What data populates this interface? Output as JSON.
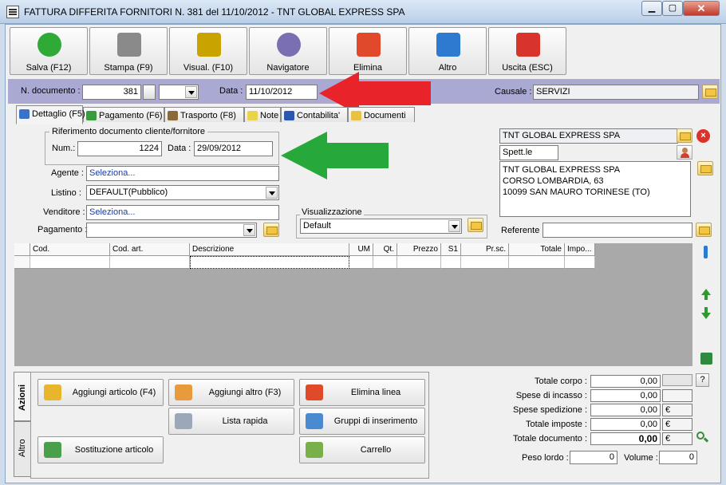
{
  "window": {
    "title": "FATTURA DIFFERITA FORNITORI N. 381  del 11/10/2012 - TNT GLOBAL EXPRESS SPA",
    "minimize": "▁",
    "maximize": "▢",
    "close": "✕"
  },
  "toolbar": [
    {
      "label": "Salva (F12)",
      "icon": "check-icon",
      "color": "#2faa36"
    },
    {
      "label": "Stampa (F9)",
      "icon": "printer-icon",
      "color": "#8a8a8a"
    },
    {
      "label": "Visual. (F10)",
      "icon": "magic-wand-icon",
      "color": "#c9a400"
    },
    {
      "label": "Navigatore",
      "icon": "compass-icon",
      "color": "#7a6fb0"
    },
    {
      "label": "Elimina",
      "icon": "delete-x-icon",
      "color": "#e04a2a"
    },
    {
      "label": "Altro",
      "icon": "search-doc-icon",
      "color": "#2e7ad1"
    },
    {
      "label": "Uscita (ESC)",
      "icon": "exit-icon",
      "color": "#d9342b"
    }
  ],
  "document": {
    "number_label": "N. documento :",
    "number": "381",
    "series": "",
    "date_label": "Data :",
    "date": "11/10/2012",
    "causale_label": "Causale :",
    "causale": "SERVIZI"
  },
  "tabs": [
    {
      "label": "Dettaglio (F5)",
      "icon": "calendar-icon",
      "color": "#3a72c9"
    },
    {
      "label": "Pagamento (F6)",
      "icon": "money-icon",
      "color": "#3b9a3b"
    },
    {
      "label": "Trasporto (F8)",
      "icon": "truck-icon",
      "color": "#8a6a3a"
    },
    {
      "label": "Note",
      "icon": "note-icon",
      "color": "#e8d34a"
    },
    {
      "label": "Contabilita'",
      "icon": "book-icon",
      "color": "#2a58b0"
    },
    {
      "label": "Documenti",
      "icon": "folder-icon",
      "color": "#e9c243"
    }
  ],
  "reference": {
    "group_label": "Riferimento documento cliente/fornitore",
    "num_label": "Num.:",
    "num": "1224",
    "date_label": "Data :",
    "date": "29/09/2012"
  },
  "fields": {
    "agente_label": "Agente :",
    "agente": "Seleziona...",
    "listino_label": "Listino :",
    "listino": "DEFAULT(Pubblico)",
    "venditore_label": "Venditore :",
    "venditore": "Seleziona...",
    "pagamento_label": "Pagamento :",
    "pagamento": "",
    "visual_label": "Visualizzazione",
    "visual": "Default"
  },
  "customer": {
    "name": "TNT GLOBAL EXPRESS SPA",
    "salutation": "Spett.le",
    "address_lines": [
      "TNT GLOBAL EXPRESS SPA",
      "CORSO LOMBARDIA, 63",
      "10099 SAN MAURO TORINESE (TO)"
    ],
    "referente_label": "Referente",
    "referente": ""
  },
  "grid": {
    "columns": [
      "Cod.",
      "Cod. art.",
      "Descrizione",
      "UM",
      "Qt.",
      "Prezzo",
      "S1",
      "Pr.sc.",
      "Totale",
      "Impo..."
    ]
  },
  "side_tabs": {
    "azioni": "Azioni",
    "altro": "Altro"
  },
  "actions": [
    {
      "label": "Aggiungi articolo (F4)",
      "icon": "add-box-icon",
      "color": "#e8b62c"
    },
    {
      "label": "Aggiungi altro (F3)",
      "icon": "add-grid-icon",
      "color": "#e89a3c"
    },
    {
      "label": "Elimina linea",
      "icon": "delete-x-icon",
      "color": "#e04a2a"
    },
    {
      "label": "Lista rapida",
      "icon": "quick-list-icon",
      "color": "#9aa8b8"
    },
    {
      "label": "Gruppi di inserimento",
      "icon": "group-insert-icon",
      "color": "#4a8ad0"
    },
    {
      "label": "Sostituzione articolo",
      "icon": "replace-icon",
      "color": "#4aa04a"
    },
    {
      "label": "Carrello",
      "icon": "cart-icon",
      "color": "#7ab04a"
    }
  ],
  "totals": [
    {
      "label": "Totale corpo :",
      "value": "0,00",
      "unit": "",
      "bold": false
    },
    {
      "label": "Spese di incasso :",
      "value": "0,00",
      "unit": "",
      "bold": false
    },
    {
      "label": "Spese spedizione :",
      "value": "0,00",
      "unit": "€",
      "bold": false
    },
    {
      "label": "Totale imposte :",
      "value": "0,00",
      "unit": "€",
      "bold": false
    },
    {
      "label": "Totale documento :",
      "value": "0,00",
      "unit": "€",
      "bold": true
    }
  ],
  "help": "?",
  "weight": {
    "peso_label": "Peso lordo :",
    "peso": "0",
    "volume_label": "Volume :",
    "volume": "0"
  }
}
